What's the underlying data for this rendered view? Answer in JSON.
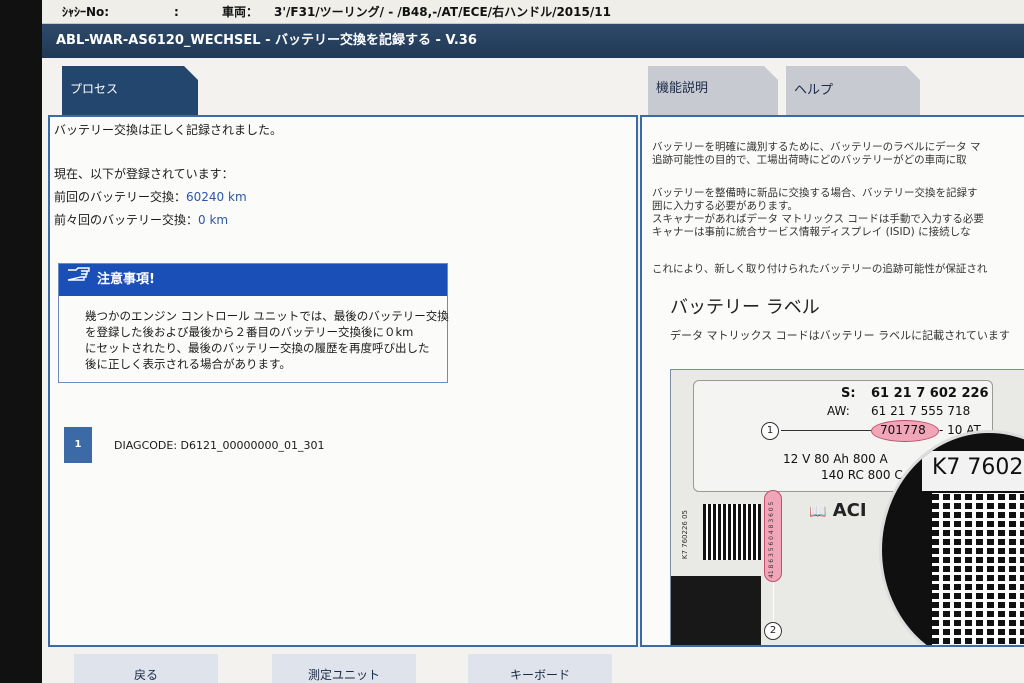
{
  "vehicle_bar": {
    "chassis_label": "ｼｬｼｰNo:",
    "colon": ":",
    "vehicle_label": "車両：",
    "vehicle_value": "3'/F31/ツーリング/ - /B48,-/AT/ECE/右ハンドル/2015/11"
  },
  "title": "ABL-WAR-AS6120_WECHSEL - バッテリー交換を記録する - V.36",
  "tabs": {
    "process": "プロセス",
    "function_description": "機能説明",
    "help": "ヘルプ"
  },
  "left": {
    "success": "バッテリー交換は正しく記録されました。",
    "registered_heading": "現在、以下が登録されています：",
    "last_label": "前回のバッテリー交換：",
    "last_value": "60240 km",
    "prev_label": "前々回のバッテリー交換：",
    "prev_value": "0 km",
    "notice": {
      "title": "注意事項!",
      "lines": [
        "幾つかのエンジン コントロール ユニットでは、最後のバッテリー交換",
        "を登録した後および最後から２番目のバッテリー交換後に０km",
        "にセットされたり、最後のバッテリー交換の履歴を再度呼び出した",
        "後に正しく表示される場合があります。"
      ]
    },
    "diag_number": "1",
    "diag_code": "DIAGCODE: D6121_00000000_01_301"
  },
  "right": {
    "paragraph1": [
      "バッテリーを明確に識別するために、バッテリーのラベルにデータ マ",
      "追跡可能性の目的で、工場出荷時にどのバッテリーがどの車両に取"
    ],
    "paragraph2": [
      "バッテリーを整備時に新品に交換する場合、バッテリー交換を記録す",
      "囲に入力する必要があります。",
      "スキャナーがあればデータ マトリックス コードは手動で入力する必要",
      "キャナーは事前に統合サービス情報ディスプレイ (ISID) に接続しな"
    ],
    "paragraph3": "これにより、新しく取り付けられたバッテリーの追跡可能性が保証され",
    "section_title": "バッテリー ラベル",
    "section_caption": "データ マトリックス コードはバッテリー ラベルに記載されています",
    "label_figure": {
      "s_label": "S:",
      "s_value": "61 21 7 602 226",
      "aw_label": "AW:",
      "aw_value": "61 21 7 555 718",
      "highlight_code": "701778",
      "highlight_suffix": "- 10 AT",
      "spec_line1": "12 V  80 Ah    800 A",
      "spec_line2": "140 RC 800 C",
      "magnified_text": "K7 7602",
      "callout_1": "1",
      "callout_2": "2",
      "vertical_code": "41 8 6 3 5 6 0 4 8 3 6 0 5",
      "side_code": "K7 760226 05",
      "brand_fragment": "ACI"
    }
  },
  "buttons": {
    "back": "戻る",
    "measure_unit": "測定ユニット",
    "keyboard": "キーボード"
  },
  "colors": {
    "title_bar": "#1f3856",
    "accent": "#3b6aa6",
    "notice_header": "#1b4fb8",
    "value_text": "#2c56a8"
  }
}
